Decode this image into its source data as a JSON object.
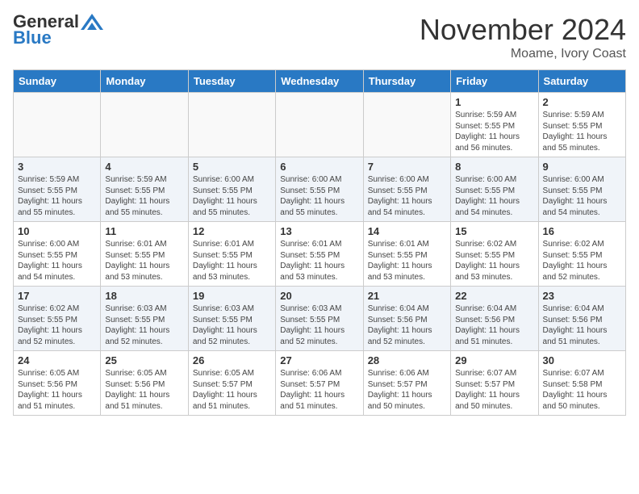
{
  "header": {
    "logo_general": "General",
    "logo_blue": "Blue",
    "month_year": "November 2024",
    "location": "Moame, Ivory Coast"
  },
  "calendar": {
    "days_of_week": [
      "Sunday",
      "Monday",
      "Tuesday",
      "Wednesday",
      "Thursday",
      "Friday",
      "Saturday"
    ],
    "weeks": [
      {
        "row_style": "normal",
        "days": [
          {
            "date": "",
            "info": ""
          },
          {
            "date": "",
            "info": ""
          },
          {
            "date": "",
            "info": ""
          },
          {
            "date": "",
            "info": ""
          },
          {
            "date": "",
            "info": ""
          },
          {
            "date": "1",
            "info": "Sunrise: 5:59 AM\nSunset: 5:55 PM\nDaylight: 11 hours\nand 56 minutes."
          },
          {
            "date": "2",
            "info": "Sunrise: 5:59 AM\nSunset: 5:55 PM\nDaylight: 11 hours\nand 55 minutes."
          }
        ]
      },
      {
        "row_style": "alt",
        "days": [
          {
            "date": "3",
            "info": "Sunrise: 5:59 AM\nSunset: 5:55 PM\nDaylight: 11 hours\nand 55 minutes."
          },
          {
            "date": "4",
            "info": "Sunrise: 5:59 AM\nSunset: 5:55 PM\nDaylight: 11 hours\nand 55 minutes."
          },
          {
            "date": "5",
            "info": "Sunrise: 6:00 AM\nSunset: 5:55 PM\nDaylight: 11 hours\nand 55 minutes."
          },
          {
            "date": "6",
            "info": "Sunrise: 6:00 AM\nSunset: 5:55 PM\nDaylight: 11 hours\nand 55 minutes."
          },
          {
            "date": "7",
            "info": "Sunrise: 6:00 AM\nSunset: 5:55 PM\nDaylight: 11 hours\nand 54 minutes."
          },
          {
            "date": "8",
            "info": "Sunrise: 6:00 AM\nSunset: 5:55 PM\nDaylight: 11 hours\nand 54 minutes."
          },
          {
            "date": "9",
            "info": "Sunrise: 6:00 AM\nSunset: 5:55 PM\nDaylight: 11 hours\nand 54 minutes."
          }
        ]
      },
      {
        "row_style": "normal",
        "days": [
          {
            "date": "10",
            "info": "Sunrise: 6:00 AM\nSunset: 5:55 PM\nDaylight: 11 hours\nand 54 minutes."
          },
          {
            "date": "11",
            "info": "Sunrise: 6:01 AM\nSunset: 5:55 PM\nDaylight: 11 hours\nand 53 minutes."
          },
          {
            "date": "12",
            "info": "Sunrise: 6:01 AM\nSunset: 5:55 PM\nDaylight: 11 hours\nand 53 minutes."
          },
          {
            "date": "13",
            "info": "Sunrise: 6:01 AM\nSunset: 5:55 PM\nDaylight: 11 hours\nand 53 minutes."
          },
          {
            "date": "14",
            "info": "Sunrise: 6:01 AM\nSunset: 5:55 PM\nDaylight: 11 hours\nand 53 minutes."
          },
          {
            "date": "15",
            "info": "Sunrise: 6:02 AM\nSunset: 5:55 PM\nDaylight: 11 hours\nand 53 minutes."
          },
          {
            "date": "16",
            "info": "Sunrise: 6:02 AM\nSunset: 5:55 PM\nDaylight: 11 hours\nand 52 minutes."
          }
        ]
      },
      {
        "row_style": "alt",
        "days": [
          {
            "date": "17",
            "info": "Sunrise: 6:02 AM\nSunset: 5:55 PM\nDaylight: 11 hours\nand 52 minutes."
          },
          {
            "date": "18",
            "info": "Sunrise: 6:03 AM\nSunset: 5:55 PM\nDaylight: 11 hours\nand 52 minutes."
          },
          {
            "date": "19",
            "info": "Sunrise: 6:03 AM\nSunset: 5:55 PM\nDaylight: 11 hours\nand 52 minutes."
          },
          {
            "date": "20",
            "info": "Sunrise: 6:03 AM\nSunset: 5:55 PM\nDaylight: 11 hours\nand 52 minutes."
          },
          {
            "date": "21",
            "info": "Sunrise: 6:04 AM\nSunset: 5:56 PM\nDaylight: 11 hours\nand 52 minutes."
          },
          {
            "date": "22",
            "info": "Sunrise: 6:04 AM\nSunset: 5:56 PM\nDaylight: 11 hours\nand 51 minutes."
          },
          {
            "date": "23",
            "info": "Sunrise: 6:04 AM\nSunset: 5:56 PM\nDaylight: 11 hours\nand 51 minutes."
          }
        ]
      },
      {
        "row_style": "normal",
        "days": [
          {
            "date": "24",
            "info": "Sunrise: 6:05 AM\nSunset: 5:56 PM\nDaylight: 11 hours\nand 51 minutes."
          },
          {
            "date": "25",
            "info": "Sunrise: 6:05 AM\nSunset: 5:56 PM\nDaylight: 11 hours\nand 51 minutes."
          },
          {
            "date": "26",
            "info": "Sunrise: 6:05 AM\nSunset: 5:57 PM\nDaylight: 11 hours\nand 51 minutes."
          },
          {
            "date": "27",
            "info": "Sunrise: 6:06 AM\nSunset: 5:57 PM\nDaylight: 11 hours\nand 51 minutes."
          },
          {
            "date": "28",
            "info": "Sunrise: 6:06 AM\nSunset: 5:57 PM\nDaylight: 11 hours\nand 50 minutes."
          },
          {
            "date": "29",
            "info": "Sunrise: 6:07 AM\nSunset: 5:57 PM\nDaylight: 11 hours\nand 50 minutes."
          },
          {
            "date": "30",
            "info": "Sunrise: 6:07 AM\nSunset: 5:58 PM\nDaylight: 11 hours\nand 50 minutes."
          }
        ]
      }
    ]
  }
}
